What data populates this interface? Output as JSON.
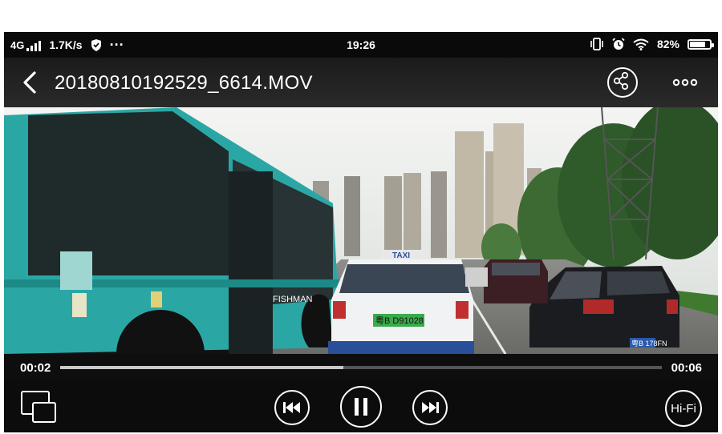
{
  "status_bar": {
    "network": "4G",
    "speed": "1.7K/s",
    "more": "···",
    "time": "19:26",
    "battery": "82%",
    "battery_level": 0.82
  },
  "title_bar": {
    "filename": "20180810192529_6614.MOV"
  },
  "player": {
    "current_time": "00:02",
    "duration": "00:06",
    "progress": 0.47,
    "hifi_label": "Hi-Fi"
  },
  "video_frame": {
    "taxi_sign": "TAXI",
    "taxi_plate": "粤B D91028",
    "car_plate": "粤B 178FN"
  },
  "colors": {
    "bus": "#2aa7a4",
    "sky": "#eef0ee",
    "road": "#7d7d7a",
    "taxi_roof": "#2a4f9a"
  }
}
